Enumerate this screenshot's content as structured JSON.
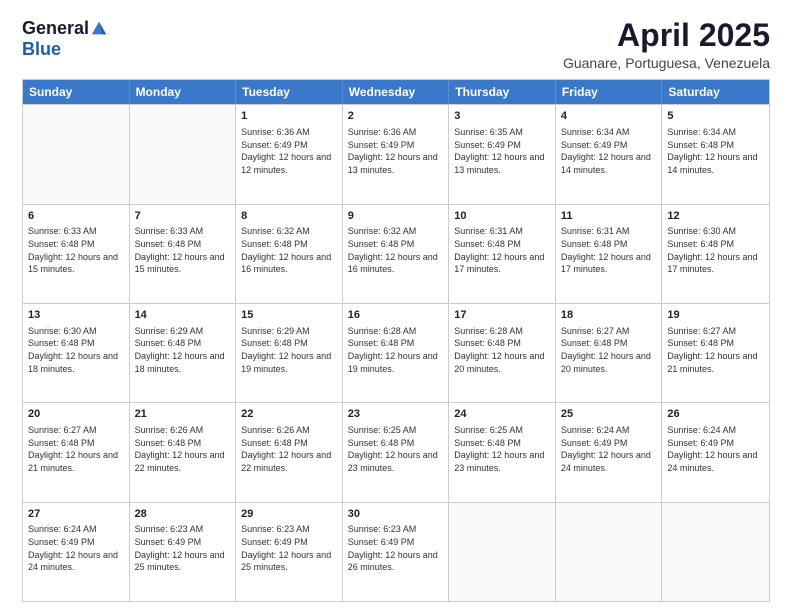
{
  "logo": {
    "general": "General",
    "blue": "Blue"
  },
  "title": "April 2025",
  "subtitle": "Guanare, Portuguesa, Venezuela",
  "header_days": [
    "Sunday",
    "Monday",
    "Tuesday",
    "Wednesday",
    "Thursday",
    "Friday",
    "Saturday"
  ],
  "weeks": [
    [
      {
        "day": "",
        "info": ""
      },
      {
        "day": "",
        "info": ""
      },
      {
        "day": "1",
        "info": "Sunrise: 6:36 AM\nSunset: 6:49 PM\nDaylight: 12 hours and 12 minutes."
      },
      {
        "day": "2",
        "info": "Sunrise: 6:36 AM\nSunset: 6:49 PM\nDaylight: 12 hours and 13 minutes."
      },
      {
        "day": "3",
        "info": "Sunrise: 6:35 AM\nSunset: 6:49 PM\nDaylight: 12 hours and 13 minutes."
      },
      {
        "day": "4",
        "info": "Sunrise: 6:34 AM\nSunset: 6:49 PM\nDaylight: 12 hours and 14 minutes."
      },
      {
        "day": "5",
        "info": "Sunrise: 6:34 AM\nSunset: 6:48 PM\nDaylight: 12 hours and 14 minutes."
      }
    ],
    [
      {
        "day": "6",
        "info": "Sunrise: 6:33 AM\nSunset: 6:48 PM\nDaylight: 12 hours and 15 minutes."
      },
      {
        "day": "7",
        "info": "Sunrise: 6:33 AM\nSunset: 6:48 PM\nDaylight: 12 hours and 15 minutes."
      },
      {
        "day": "8",
        "info": "Sunrise: 6:32 AM\nSunset: 6:48 PM\nDaylight: 12 hours and 16 minutes."
      },
      {
        "day": "9",
        "info": "Sunrise: 6:32 AM\nSunset: 6:48 PM\nDaylight: 12 hours and 16 minutes."
      },
      {
        "day": "10",
        "info": "Sunrise: 6:31 AM\nSunset: 6:48 PM\nDaylight: 12 hours and 17 minutes."
      },
      {
        "day": "11",
        "info": "Sunrise: 6:31 AM\nSunset: 6:48 PM\nDaylight: 12 hours and 17 minutes."
      },
      {
        "day": "12",
        "info": "Sunrise: 6:30 AM\nSunset: 6:48 PM\nDaylight: 12 hours and 17 minutes."
      }
    ],
    [
      {
        "day": "13",
        "info": "Sunrise: 6:30 AM\nSunset: 6:48 PM\nDaylight: 12 hours and 18 minutes."
      },
      {
        "day": "14",
        "info": "Sunrise: 6:29 AM\nSunset: 6:48 PM\nDaylight: 12 hours and 18 minutes."
      },
      {
        "day": "15",
        "info": "Sunrise: 6:29 AM\nSunset: 6:48 PM\nDaylight: 12 hours and 19 minutes."
      },
      {
        "day": "16",
        "info": "Sunrise: 6:28 AM\nSunset: 6:48 PM\nDaylight: 12 hours and 19 minutes."
      },
      {
        "day": "17",
        "info": "Sunrise: 6:28 AM\nSunset: 6:48 PM\nDaylight: 12 hours and 20 minutes."
      },
      {
        "day": "18",
        "info": "Sunrise: 6:27 AM\nSunset: 6:48 PM\nDaylight: 12 hours and 20 minutes."
      },
      {
        "day": "19",
        "info": "Sunrise: 6:27 AM\nSunset: 6:48 PM\nDaylight: 12 hours and 21 minutes."
      }
    ],
    [
      {
        "day": "20",
        "info": "Sunrise: 6:27 AM\nSunset: 6:48 PM\nDaylight: 12 hours and 21 minutes."
      },
      {
        "day": "21",
        "info": "Sunrise: 6:26 AM\nSunset: 6:48 PM\nDaylight: 12 hours and 22 minutes."
      },
      {
        "day": "22",
        "info": "Sunrise: 6:26 AM\nSunset: 6:48 PM\nDaylight: 12 hours and 22 minutes."
      },
      {
        "day": "23",
        "info": "Sunrise: 6:25 AM\nSunset: 6:48 PM\nDaylight: 12 hours and 23 minutes."
      },
      {
        "day": "24",
        "info": "Sunrise: 6:25 AM\nSunset: 6:48 PM\nDaylight: 12 hours and 23 minutes."
      },
      {
        "day": "25",
        "info": "Sunrise: 6:24 AM\nSunset: 6:49 PM\nDaylight: 12 hours and 24 minutes."
      },
      {
        "day": "26",
        "info": "Sunrise: 6:24 AM\nSunset: 6:49 PM\nDaylight: 12 hours and 24 minutes."
      }
    ],
    [
      {
        "day": "27",
        "info": "Sunrise: 6:24 AM\nSunset: 6:49 PM\nDaylight: 12 hours and 24 minutes."
      },
      {
        "day": "28",
        "info": "Sunrise: 6:23 AM\nSunset: 6:49 PM\nDaylight: 12 hours and 25 minutes."
      },
      {
        "day": "29",
        "info": "Sunrise: 6:23 AM\nSunset: 6:49 PM\nDaylight: 12 hours and 25 minutes."
      },
      {
        "day": "30",
        "info": "Sunrise: 6:23 AM\nSunset: 6:49 PM\nDaylight: 12 hours and 26 minutes."
      },
      {
        "day": "",
        "info": ""
      },
      {
        "day": "",
        "info": ""
      },
      {
        "day": "",
        "info": ""
      }
    ]
  ]
}
